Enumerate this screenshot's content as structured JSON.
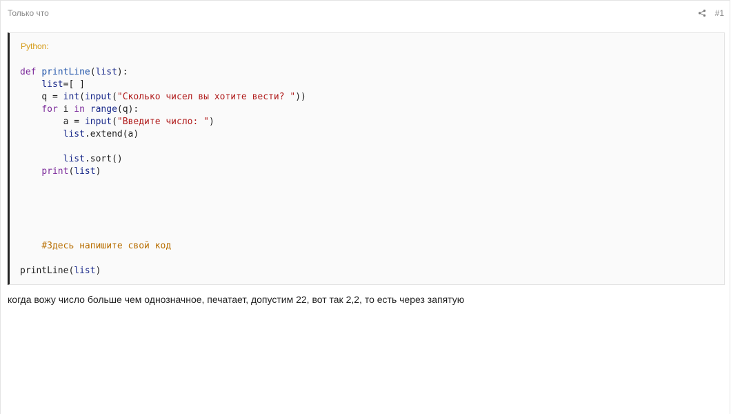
{
  "post": {
    "time": "Только что",
    "number": "#1",
    "share_icon": "share-icon",
    "text": "когда вожу число больше чем однозначное, печатает, допустим 22, вот так 2,2, то есть через запятую"
  },
  "code": {
    "language": "Python:",
    "tokens": {
      "def": "def",
      "printLine": "printLine",
      "list": "list",
      "q": "q",
      "int": "int",
      "input": "input",
      "prompt_count": "\"Сколько чисел вы хотите вести? \"",
      "for": "for",
      "i": "i",
      "in": "in",
      "range": "range",
      "a": "a",
      "prompt_number": "\"Введите число: \"",
      "extend": ".extend(a)",
      "sort": ".sort()",
      "print": "print",
      "comment": "#Здесь напишите свой код"
    }
  },
  "colors": {
    "keyword": "#7b2a9a",
    "function_name": "#2255aa",
    "builtin": "#1a2a8a",
    "string": "#b01b1b",
    "comment": "#b86e00",
    "language_label": "#d49a16",
    "code_border": "#222222"
  }
}
